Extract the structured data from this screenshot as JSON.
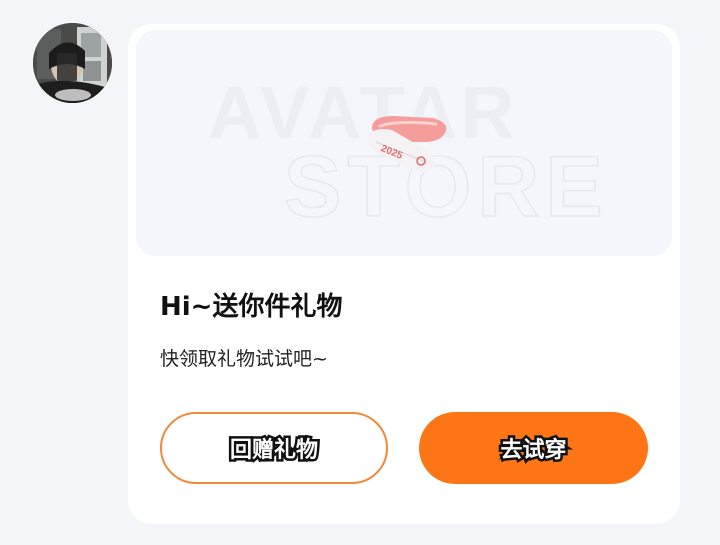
{
  "sender": {
    "avatar_icon": "user-avatar-photo"
  },
  "gift_card": {
    "banner": {
      "watermark_line1": "AVATAR",
      "watermark_line2": "STORE",
      "item_icon": "hair-clip-icon",
      "item_text": "2025"
    },
    "title": "Hi~送你件礼物",
    "subtitle": "快领取礼物试试吧~",
    "buttons": {
      "return_gift_label": "回赠礼物",
      "try_on_label": "去试穿"
    },
    "colors": {
      "accent": "#fd7514",
      "outline": "#ef8a3f",
      "card": "#ffffff",
      "background": "#f3f5f8"
    }
  }
}
